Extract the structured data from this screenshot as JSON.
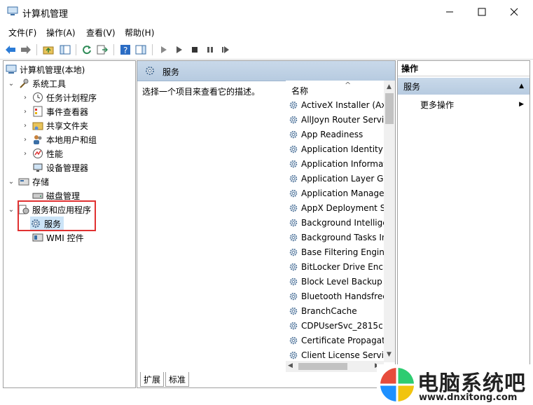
{
  "window": {
    "title": "计算机管理",
    "min_icon": "minimize-icon",
    "max_icon": "maximize-icon",
    "close_icon": "close-icon"
  },
  "menu": [
    "文件(F)",
    "操作(A)",
    "查看(V)",
    "帮助(H)"
  ],
  "tree": {
    "root": "计算机管理(本地)",
    "system_tools": "系统工具",
    "task_scheduler": "任务计划程序",
    "event_viewer": "事件查看器",
    "shared_folders": "共享文件夹",
    "local_users": "本地用户和组",
    "performance": "性能",
    "device_manager": "设备管理器",
    "storage": "存储",
    "disk_management": "磁盘管理",
    "services_apps": "服务和应用程序",
    "services": "服务",
    "wmi": "WMI 控件"
  },
  "middle": {
    "header": "服务",
    "description": "选择一个项目来查看它的描述。",
    "column_name": "名称",
    "services": [
      "ActiveX Installer (AxInstSV)",
      "AllJoyn Router Service",
      "App Readiness",
      "Application Identity",
      "Application Information",
      "Application Layer Gateway Service",
      "Application Management",
      "AppX Deployment Service",
      "Background Intelligent Transfer",
      "Background Tasks Infrastructure",
      "Base Filtering Engine",
      "BitLocker Drive Encryption",
      "Block Level Backup Engine",
      "Bluetooth Handsfree Service",
      "BranchCache",
      "CDPUserSvc_2815c",
      "Certificate Propagation",
      "Client License Service"
    ],
    "tabs": [
      "扩展",
      "标准"
    ]
  },
  "actions": {
    "title": "操作",
    "section": "服务",
    "more": "更多操作"
  },
  "watermark": {
    "brand": "电脑系统吧",
    "url": "www.dnxitong.com"
  },
  "colors": {
    "accent_header": "#c0d4e8",
    "highlight_box": "#e03131"
  }
}
